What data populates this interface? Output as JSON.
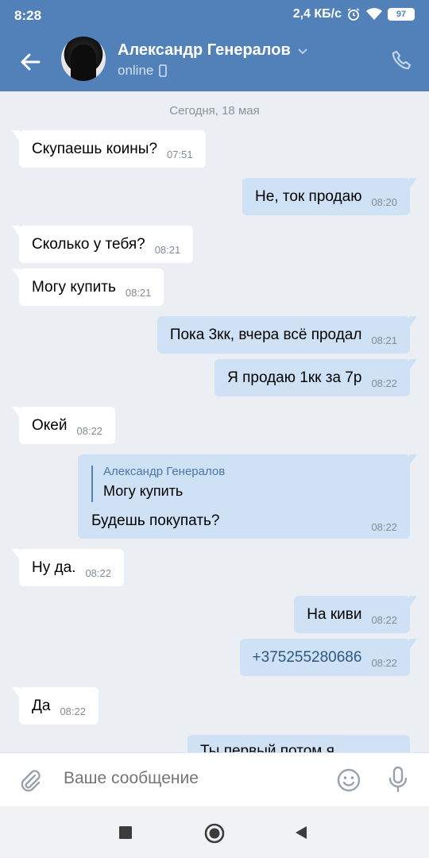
{
  "status_bar": {
    "time": "8:28",
    "speed": "2,4 КБ/с",
    "battery": "97"
  },
  "header": {
    "name": "Александр Генералов",
    "status": "online",
    "icons": {
      "back": "back-arrow-icon",
      "phone": "phone-icon",
      "chevron": "chevron-down-icon",
      "mobile": "mobile-device-icon"
    }
  },
  "chat": {
    "date": "Сегодня, 18 мая",
    "messages": [
      {
        "dir": "in",
        "text": "Скупаешь коины?",
        "time": "07:51"
      },
      {
        "dir": "out",
        "text": "Не, ток продаю",
        "time": "08:20"
      },
      {
        "dir": "in",
        "text": "Сколько у тебя?",
        "time": "08:21"
      },
      {
        "dir": "in",
        "text": "Могу купить",
        "time": "08:21"
      },
      {
        "dir": "out",
        "text": "Пока 3кк, вчера всё продал",
        "time": "08:21"
      },
      {
        "dir": "out",
        "text": "Я продаю 1кк за 7р",
        "time": "08:22"
      },
      {
        "dir": "in",
        "text": "Окей",
        "time": "08:22"
      },
      {
        "dir": "out",
        "text": "Будешь покупать?",
        "time": "08:22",
        "quote_author": "Александр Генералов",
        "quote_text": "Могу купить"
      },
      {
        "dir": "in",
        "text": "Ну да.",
        "time": "08:22"
      },
      {
        "dir": "out",
        "text": "На киви",
        "time": "08:22"
      },
      {
        "dir": "out",
        "text": "+375255280686",
        "time": "08:22"
      },
      {
        "dir": "in",
        "text": "Да",
        "time": "08:22"
      },
      {
        "dir": "out",
        "text": "Ты первый потом я"
      }
    ]
  },
  "composer": {
    "placeholder": "Ваше сообщение",
    "icons": {
      "attach": "paperclip-icon",
      "emoji": "smile-icon",
      "voice": "microphone-icon"
    }
  },
  "colors": {
    "accent": "#5181b8",
    "outgoing": "#cfe1f5",
    "incoming": "#ffffff",
    "background": "#ebeef3"
  }
}
